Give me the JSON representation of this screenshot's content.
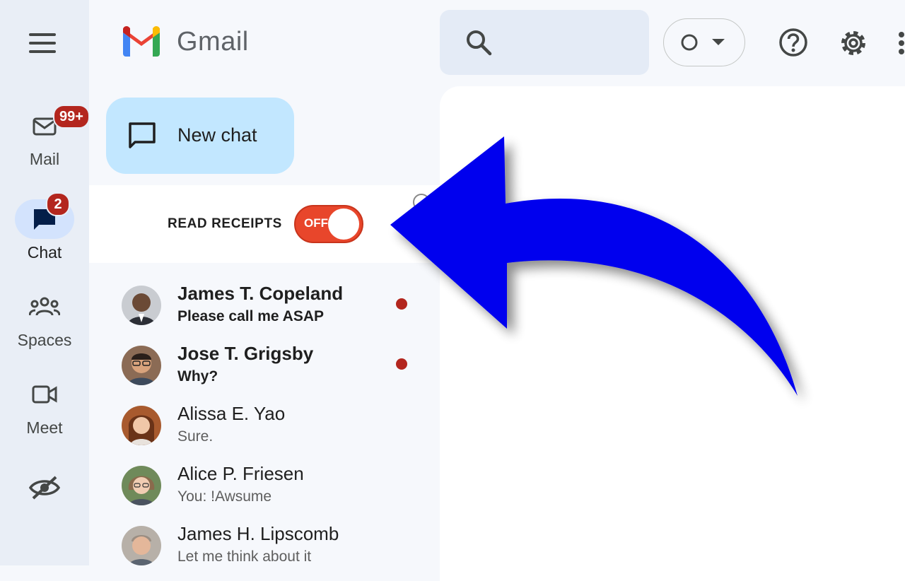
{
  "app": {
    "logo_text": "Gmail"
  },
  "rail": {
    "items": [
      {
        "id": "mail",
        "label": "Mail",
        "icon": "mail-icon",
        "badge": "99+"
      },
      {
        "id": "chat",
        "label": "Chat",
        "icon": "chat-icon",
        "badge": "2",
        "active": true
      },
      {
        "id": "spaces",
        "label": "Spaces",
        "icon": "spaces-icon"
      },
      {
        "id": "meet",
        "label": "Meet",
        "icon": "meet-icon"
      },
      {
        "id": "hide",
        "label": "",
        "icon": "eye-off-icon"
      }
    ]
  },
  "header": {
    "search_icon": "search-icon",
    "status_icon": "status-circle-icon",
    "help_icon": "help-icon",
    "settings_icon": "gear-icon",
    "more_icon": "more-vert-icon"
  },
  "new_chat": {
    "label": "New chat"
  },
  "read_receipts": {
    "label": "READ RECEIPTS",
    "toggle_text": "OFF",
    "state": "off",
    "toggle_color": "#e8462b"
  },
  "chats": [
    {
      "name": "James T. Copeland",
      "message": "Please call me ASAP",
      "unread": true
    },
    {
      "name": "Jose T. Grigsby",
      "message": "Why?",
      "unread": true
    },
    {
      "name": "Alissa E. Yao",
      "message": "Sure.",
      "unread": false
    },
    {
      "name": "Alice P. Friesen",
      "message": "You: !Awsume",
      "unread": false
    },
    {
      "name": "James H. Lipscomb",
      "message": "Let me think about it",
      "unread": false
    }
  ],
  "colors": {
    "accent": "#c2e7ff",
    "unread_dot": "#b3261e",
    "badge": "#b3261e",
    "annotation_arrow": "#0000ee"
  }
}
